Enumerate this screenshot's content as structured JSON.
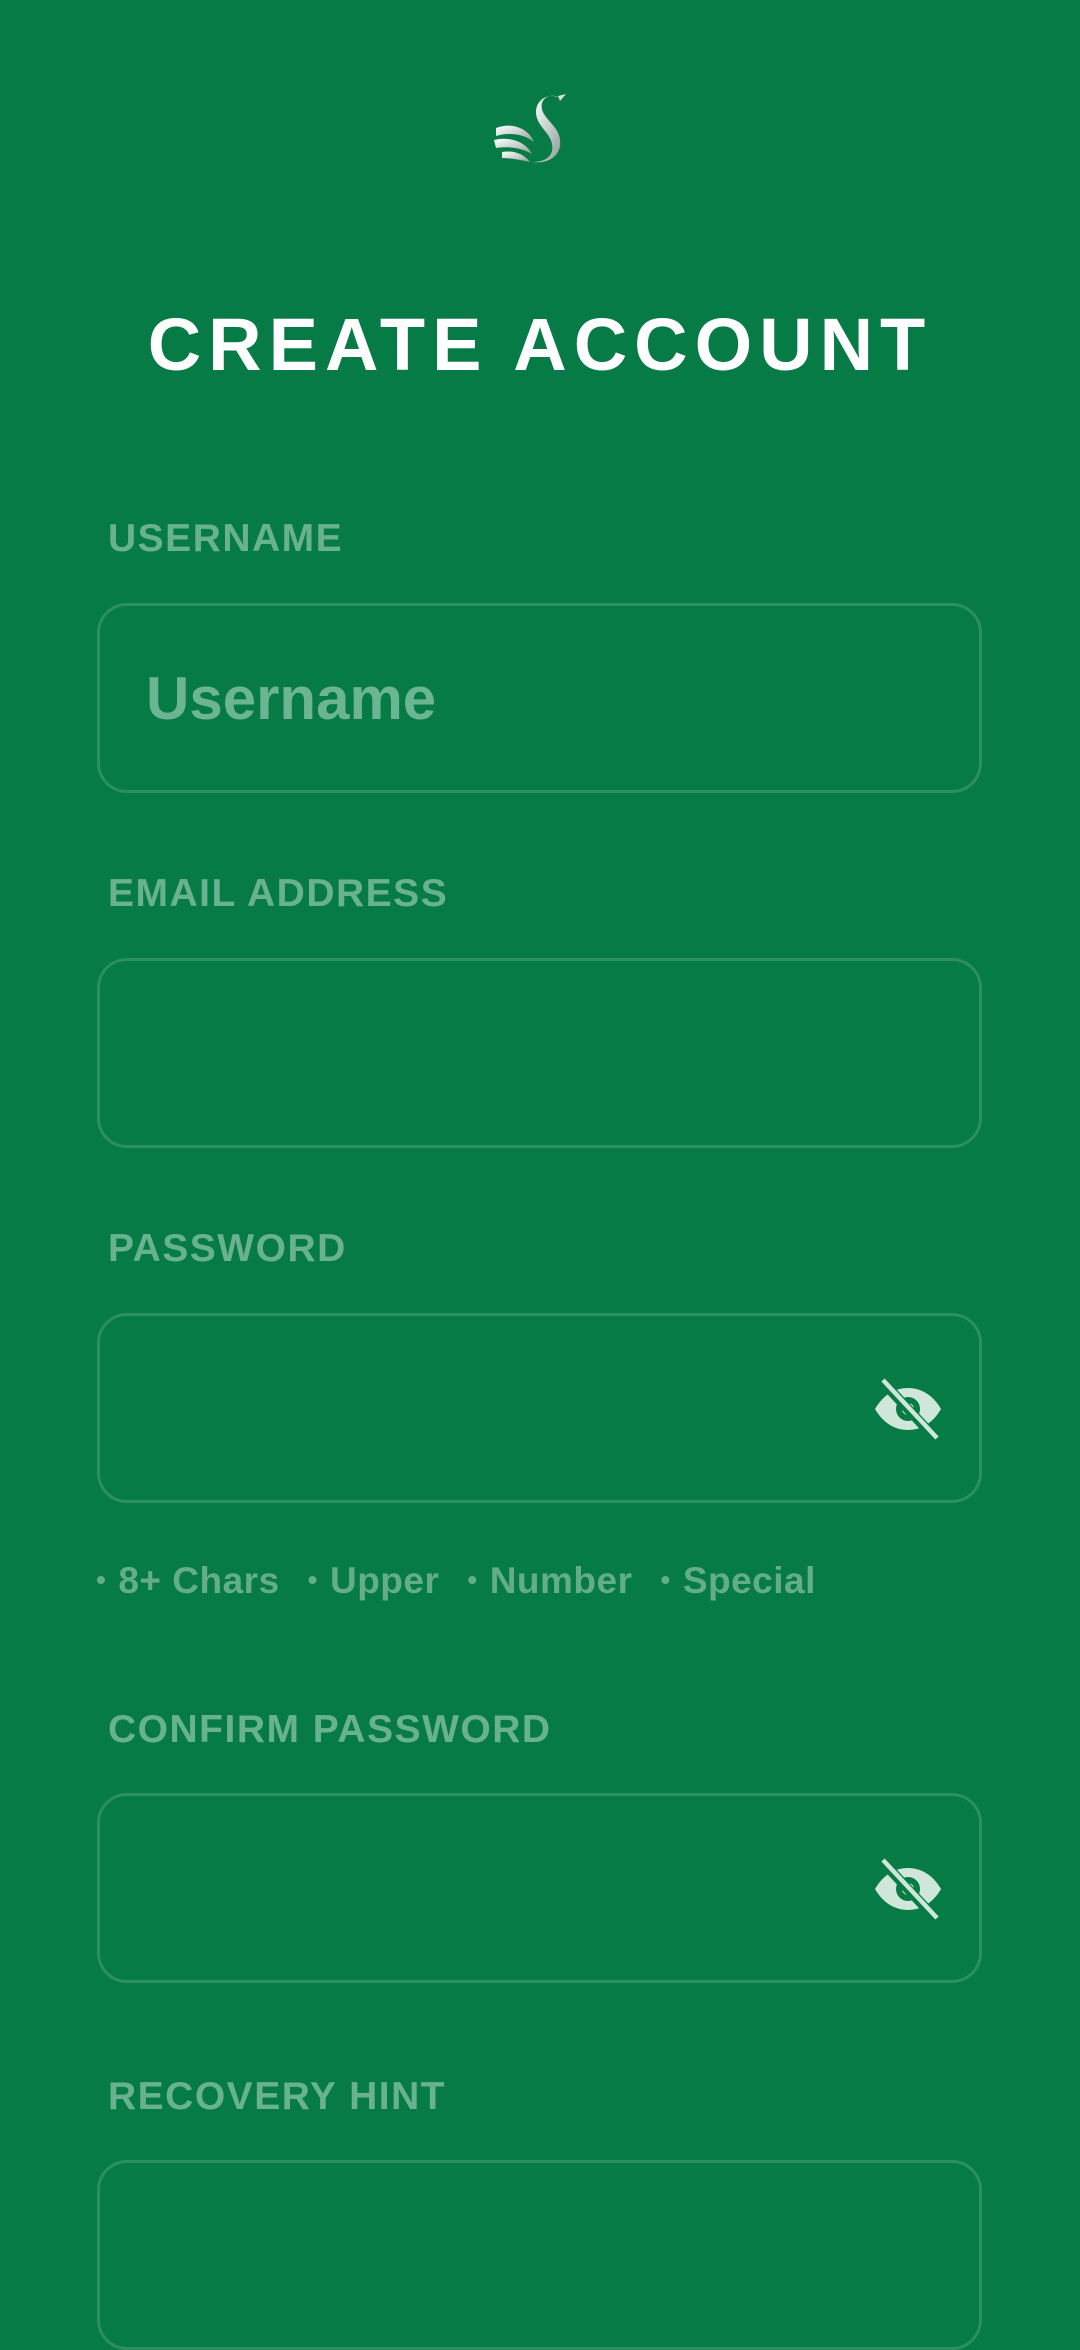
{
  "header": {
    "logo_icon": "swan-icon",
    "title": "CREATE ACCOUNT"
  },
  "form": {
    "username": {
      "label": "USERNAME",
      "placeholder": "Username",
      "value": ""
    },
    "email": {
      "label": "EMAIL ADDRESS",
      "placeholder": "",
      "value": ""
    },
    "password": {
      "label": "PASSWORD",
      "value": "",
      "toggle_icon": "eye-off-icon"
    },
    "password_requirements": [
      {
        "bullet": "•",
        "text": "8+ Chars"
      },
      {
        "bullet": "•",
        "text": "Upper"
      },
      {
        "bullet": "•",
        "text": "Number"
      },
      {
        "bullet": "•",
        "text": "Special"
      }
    ],
    "confirm_password": {
      "label": "CONFIRM PASSWORD",
      "value": "",
      "toggle_icon": "eye-off-icon"
    },
    "recovery_hint": {
      "label": "RECOVERY HINT",
      "value": ""
    }
  },
  "colors": {
    "background": "#067b45",
    "label": "#69b28f",
    "field_border": "#2c8f61",
    "title": "#ffffff"
  }
}
